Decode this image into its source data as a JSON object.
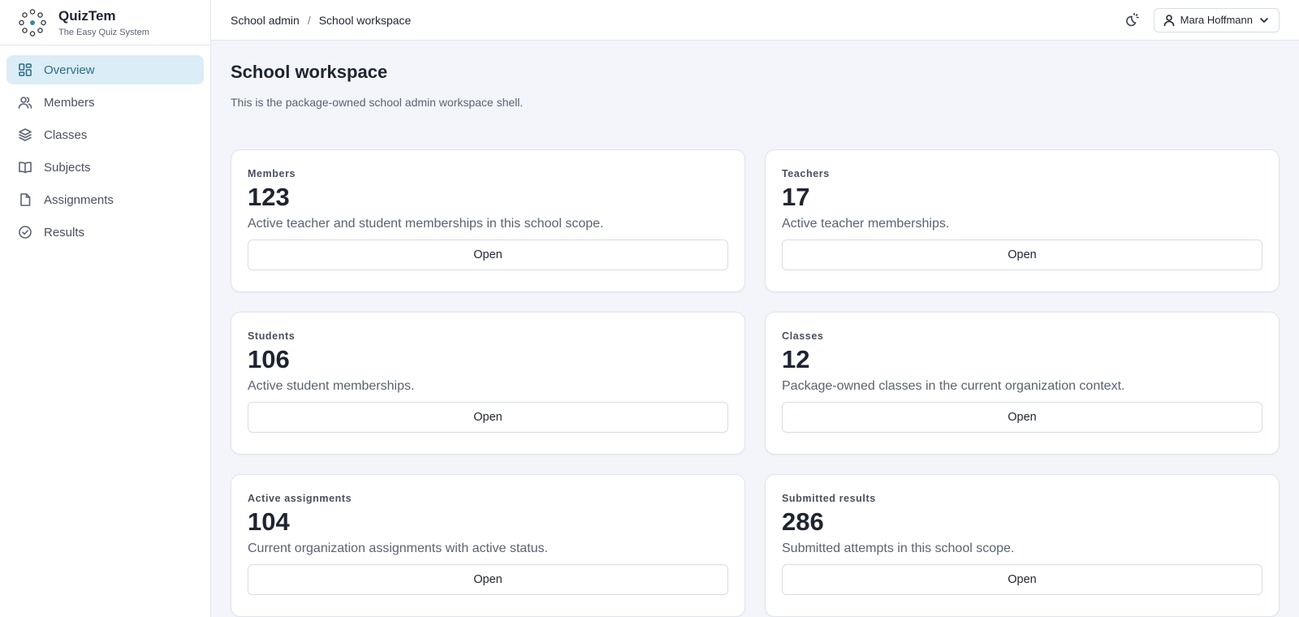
{
  "brand": {
    "name": "QuizTem",
    "tagline": "The Easy Quiz System"
  },
  "sidebar": {
    "items": [
      {
        "label": "Overview",
        "icon": "dashboard-icon",
        "active": true
      },
      {
        "label": "Members",
        "icon": "users-icon",
        "active": false
      },
      {
        "label": "Classes",
        "icon": "layers-icon",
        "active": false
      },
      {
        "label": "Subjects",
        "icon": "book-icon",
        "active": false
      },
      {
        "label": "Assignments",
        "icon": "file-icon",
        "active": false
      },
      {
        "label": "Results",
        "icon": "check-circle-icon",
        "active": false
      }
    ]
  },
  "topbar": {
    "breadcrumb": [
      "School admin",
      "School workspace"
    ],
    "breadcrumb_separator": "/",
    "user_name": "Mara Hoffmann"
  },
  "page": {
    "title": "School workspace",
    "subtitle": "This is the package-owned school admin workspace shell."
  },
  "cards": [
    {
      "label": "Members",
      "value": "123",
      "description": "Active teacher and student memberships in this school scope.",
      "button": "Open"
    },
    {
      "label": "Teachers",
      "value": "17",
      "description": "Active teacher memberships.",
      "button": "Open"
    },
    {
      "label": "Students",
      "value": "106",
      "description": "Active student memberships.",
      "button": "Open"
    },
    {
      "label": "Classes",
      "value": "12",
      "description": "Package-owned classes in the current organization context.",
      "button": "Open"
    },
    {
      "label": "Active assignments",
      "value": "104",
      "description": "Current organization assignments with active status.",
      "button": "Open"
    },
    {
      "label": "Submitted results",
      "value": "286",
      "description": "Submitted attempts in this school scope.",
      "button": "Open"
    }
  ],
  "colors": {
    "accent": "#2e6d88",
    "active_bg": "#dbedf6",
    "page_bg": "#f3f5fa"
  }
}
